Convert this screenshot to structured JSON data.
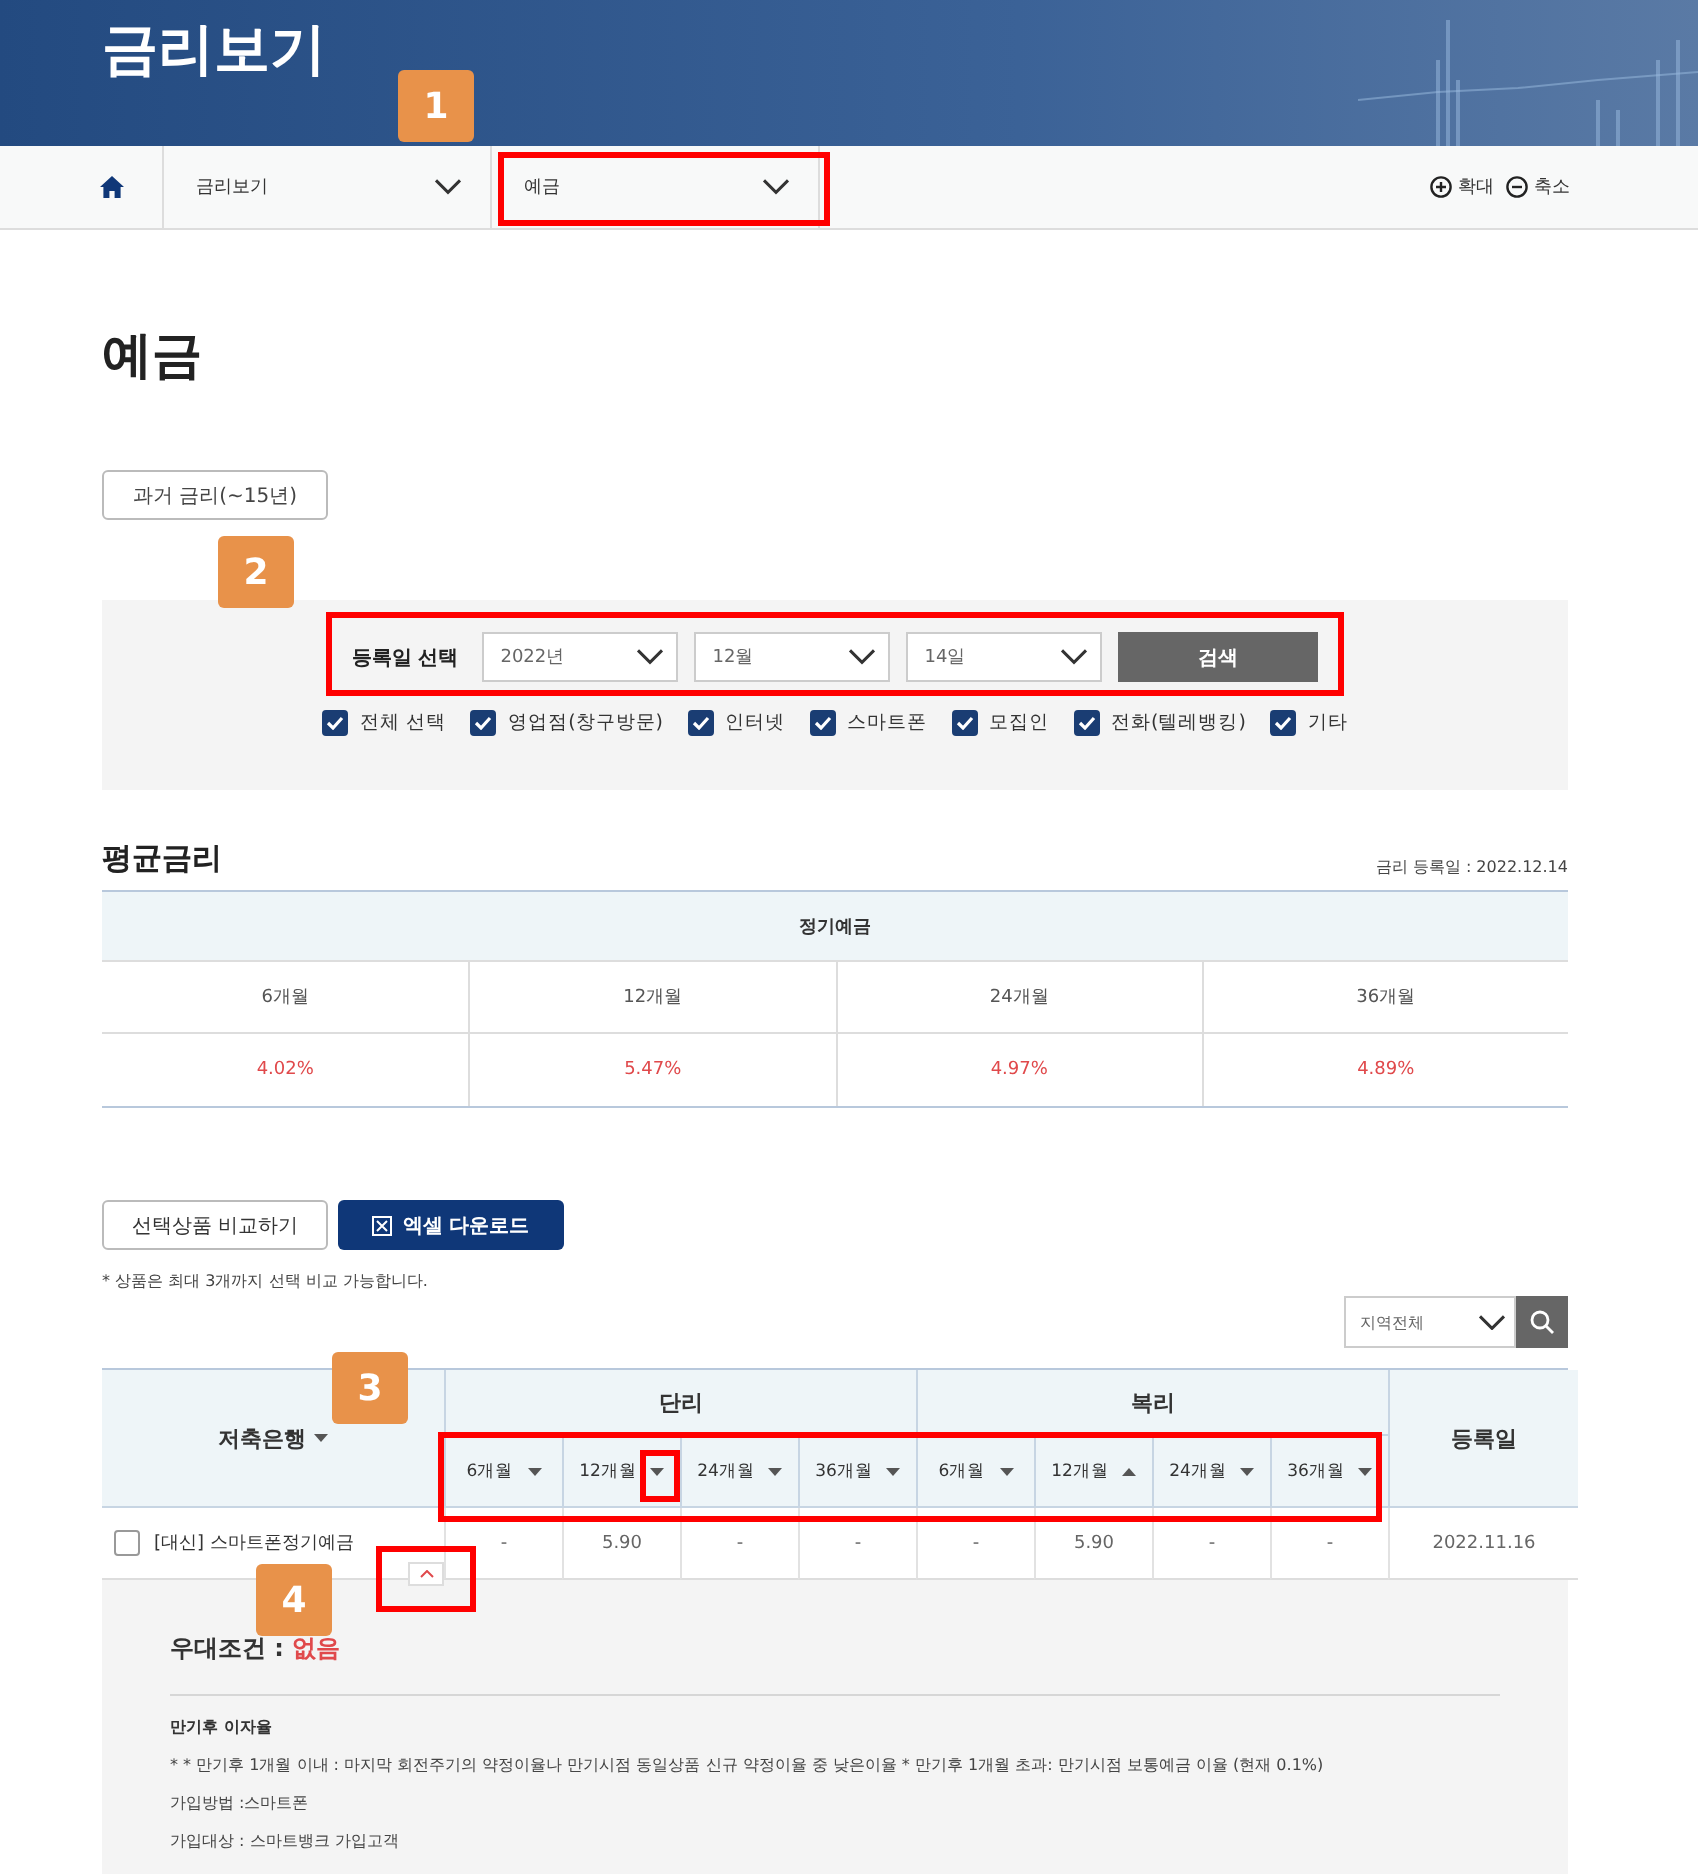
{
  "header": {
    "title": "금리보기"
  },
  "breadcrumb": {
    "items": [
      {
        "label": "금리보기"
      },
      {
        "label": "예금"
      }
    ],
    "zoom_in": "확대",
    "zoom_out": "축소"
  },
  "page_title": "예금",
  "history_button": "과거 금리(~15년)",
  "search": {
    "label": "등록일 선택",
    "year": "2022년",
    "month": "12월",
    "day": "14일",
    "button": "검색",
    "channels": [
      {
        "label": "전체 선택",
        "checked": true
      },
      {
        "label": "영업점(창구방문)",
        "checked": true
      },
      {
        "label": "인터넷",
        "checked": true
      },
      {
        "label": "스마트폰",
        "checked": true
      },
      {
        "label": "모집인",
        "checked": true
      },
      {
        "label": "전화(텔레뱅킹)",
        "checked": true
      },
      {
        "label": "기타",
        "checked": true
      }
    ]
  },
  "average": {
    "title": "평균금리",
    "date": "금리 등록일 : 2022.12.14",
    "group": "정기예금",
    "terms": [
      {
        "term": "6개월",
        "rate": "4.02%"
      },
      {
        "term": "12개월",
        "rate": "5.47%"
      },
      {
        "term": "24개월",
        "rate": "4.97%"
      },
      {
        "term": "36개월",
        "rate": "4.89%"
      }
    ]
  },
  "actions": {
    "compare": "선택상품 비교하기",
    "excel": "엑셀 다운로드",
    "note": "* 상품은 최대 3개까지 선택 비교 가능합니다.",
    "region": "지역전체"
  },
  "products": {
    "bank_header": "저축은행",
    "date_header": "등록일",
    "groups": [
      {
        "label": "단리",
        "terms": [
          {
            "label": "6개월",
            "ascending": false
          },
          {
            "label": "12개월",
            "ascending": false
          },
          {
            "label": "24개월",
            "ascending": false
          },
          {
            "label": "36개월",
            "ascending": false
          }
        ]
      },
      {
        "label": "복리",
        "terms": [
          {
            "label": "6개월",
            "ascending": false
          },
          {
            "label": "12개월",
            "ascending": true
          },
          {
            "label": "24개월",
            "ascending": false
          },
          {
            "label": "36개월",
            "ascending": false
          }
        ]
      }
    ],
    "rows": [
      {
        "checked": false,
        "name": "[대신] 스마트폰정기예금",
        "values": [
          "-",
          "5.90",
          "-",
          "-",
          "-",
          "5.90",
          "-",
          "-"
        ],
        "date": "2022.11.16",
        "expanded": true
      }
    ],
    "detail": {
      "label": "우대조건 : ",
      "value": "없음",
      "heading": "만기후 이자율",
      "lines": [
        "* * 만기후 1개월 이내 : 마지막 회전주기의 약정이율나 만기시점 동일상품 신규 약정이율 중 낮은이율 * 만기후 1개월 초과: 만기시점 보통예금 이율 (현재 0.1%)",
        "가입방법 :스마트폰",
        "가입대상 : 스마트뱅크 가입고객"
      ]
    }
  },
  "annotations": [
    "1",
    "2",
    "3",
    "4"
  ]
}
